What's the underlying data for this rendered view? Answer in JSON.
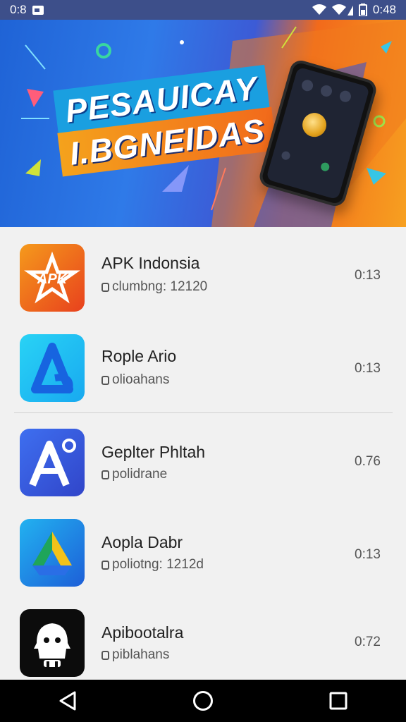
{
  "status_bar": {
    "time_left": "0:8",
    "time_right": "0:48"
  },
  "banner": {
    "title_line_1": "PESAUICAY",
    "title_line_2": "I.BGNEIDAS"
  },
  "apps": [
    {
      "name": "APK Indonsia",
      "subtitle": "clumbng: 12120",
      "time": "0:13"
    },
    {
      "name": "Rople Ario",
      "subtitle": "olioahans",
      "time": "0:13"
    },
    {
      "name": "Geplter Phltah",
      "subtitle": "polidrane",
      "time": "0.76"
    },
    {
      "name": "Aopla Dabr",
      "subtitle": "poliotng: 1212d",
      "time": "0:13"
    },
    {
      "name": "Apibootalra",
      "subtitle": "piblahans",
      "time": "0:72"
    }
  ],
  "icon_labels": {
    "app1": "APK"
  },
  "colors": {
    "status_bar": "#3d4f8a",
    "accent_blue": "#1f63d6",
    "accent_orange": "#f26a1b",
    "nav_bar": "#000000"
  }
}
